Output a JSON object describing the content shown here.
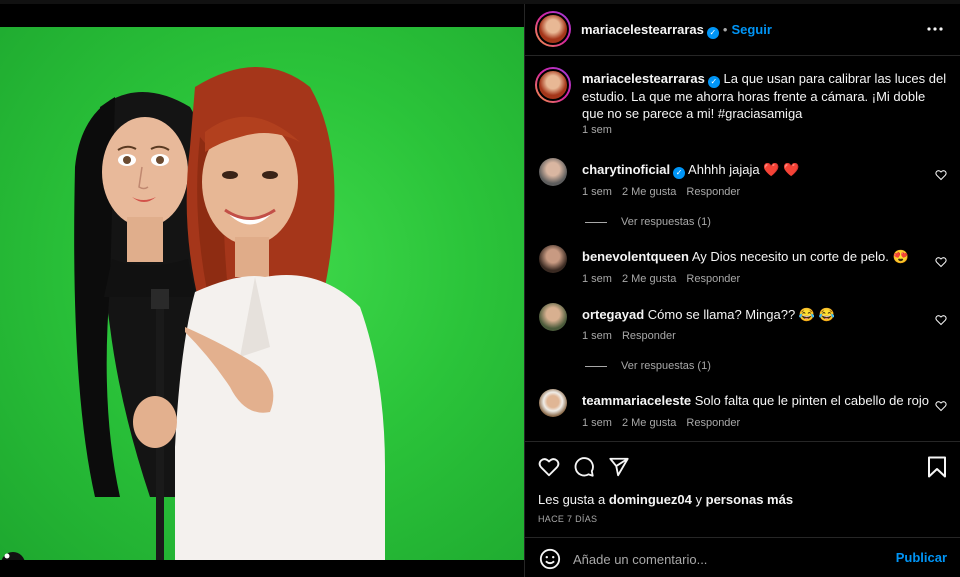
{
  "post": {
    "author": "mariacelestearraras",
    "follow_label": "Seguir",
    "separator": "•",
    "more_icon": "more-horizontal-icon",
    "caption": "La que usan para calibrar las luces del estudio. La que me ahorra horas frente a cámara. ¡Mi doble que no se parece a mi! #graciasamiga",
    "caption_time": "1 sem"
  },
  "comments": [
    {
      "user": "charytinoficial",
      "verified": true,
      "text": "Ahhhh jajaja ❤️ ❤️",
      "time": "1 sem",
      "likes": "2 Me gusta",
      "reply": "Responder",
      "view_replies": "Ver respuestas (1)"
    },
    {
      "user": "benevolentqueen",
      "verified": false,
      "text": "Ay Dios necesito un corte de pelo. 😍",
      "time": "1 sem",
      "likes": "2 Me gusta",
      "reply": "Responder"
    },
    {
      "user": "ortegayad",
      "verified": false,
      "text": "Cómo se llama? Minga?? 😂 😂",
      "time": "1 sem",
      "reply": "Responder",
      "view_replies": "Ver respuestas (1)"
    },
    {
      "user": "teammariaceleste",
      "verified": false,
      "text": "Solo falta que le pinten el cabello de rojo",
      "time": "1 sem",
      "likes": "2 Me gusta",
      "reply": "Responder"
    }
  ],
  "likes_line": {
    "prefix": "Les gusta a ",
    "user": "dominguez04",
    "middle": " y ",
    "suffix": "personas más"
  },
  "posted_ago": "HACE 7 DÍAS",
  "add_comment": {
    "placeholder": "Añade un comentario...",
    "publish": "Publicar"
  },
  "colors": {
    "accent": "#0095f6",
    "background": "#000000",
    "green_screen": "#2bc43a",
    "heart_red": "#ff3040"
  }
}
